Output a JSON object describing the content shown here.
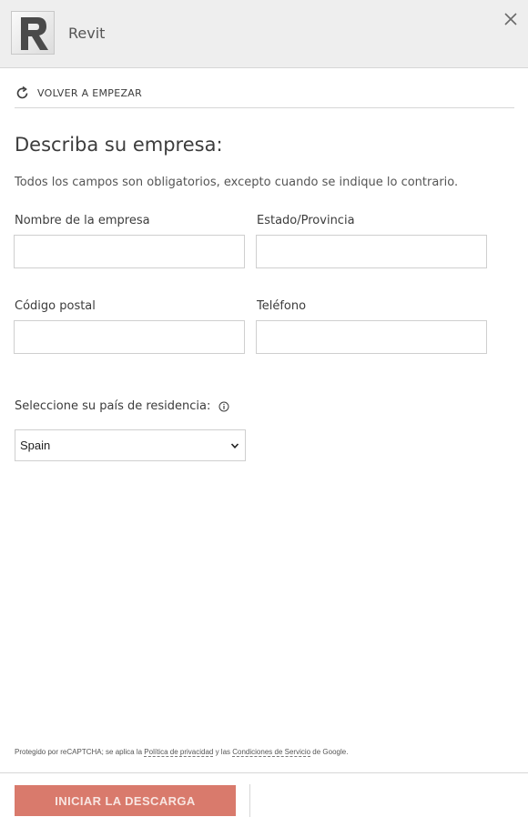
{
  "header": {
    "app_title": "Revit",
    "logo_letter": "R"
  },
  "restart": {
    "label": "VOLVER A EMPEZAR"
  },
  "form": {
    "heading": "Describa su empresa:",
    "note": "Todos los campos son obligatorios, excepto cuando se indique lo contrario.",
    "company_name": {
      "label": "Nombre de la empresa",
      "value": ""
    },
    "state": {
      "label": "Estado/Provincia",
      "value": ""
    },
    "postal_code": {
      "label": "Código postal",
      "value": ""
    },
    "phone": {
      "label": "Teléfono",
      "value": ""
    },
    "country": {
      "label": "Seleccione su país de residencia:",
      "selected": "Spain"
    }
  },
  "recaptcha": {
    "prefix": "Protegido por reCAPTCHA; se aplica la ",
    "privacy_link": "Política de privacidad",
    "middle": " y las ",
    "terms_link": "Condiciones de Servicio",
    "suffix": " de Google."
  },
  "footer": {
    "download_label": "INICIAR LA DESCARGA"
  },
  "colors": {
    "header_bg": "#eeeeee",
    "accent": "#d97a6c",
    "border": "#cfcfcf"
  }
}
